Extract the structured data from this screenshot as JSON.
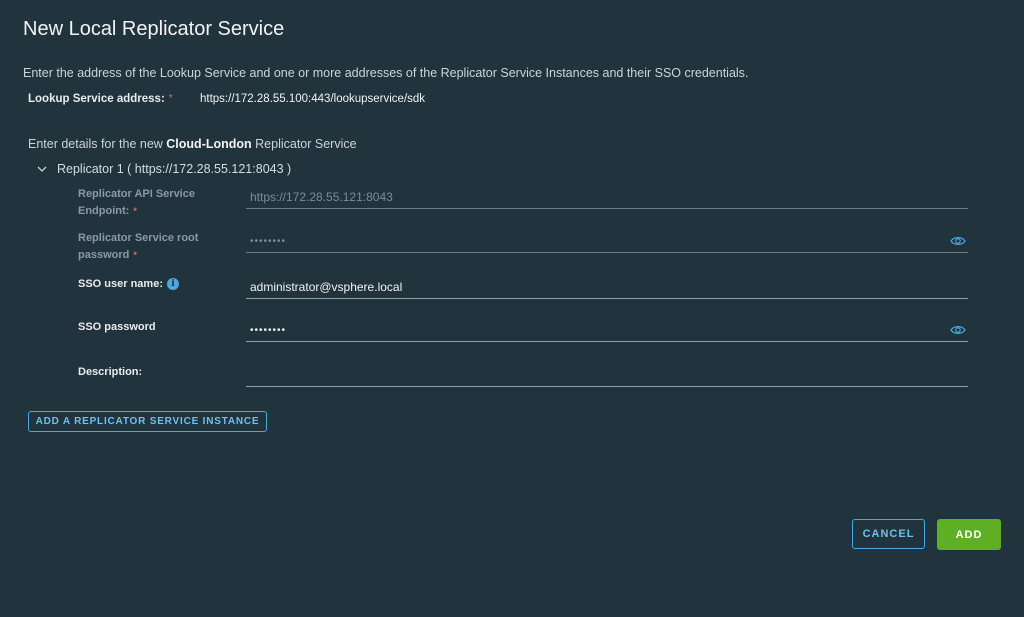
{
  "dialog": {
    "title": "New Local Replicator Service",
    "intro": "Enter the address of the Lookup Service and one or more addresses of the Replicator Service Instances and their SSO credentials."
  },
  "lookup": {
    "label": "Lookup Service address:",
    "required_mark": "*",
    "value": "https://172.28.55.100:443/lookupservice/sdk"
  },
  "details": {
    "prefix": "Enter details for the new ",
    "site_name": "Cloud-London",
    "suffix": " Replicator Service"
  },
  "replicator": {
    "header": "Replicator 1 ( https://172.28.55.121:8043 )",
    "expanded": true,
    "fields": {
      "endpoint": {
        "label_line1": "Replicator API Service",
        "label_line2": "Endpoint:",
        "required_mark": "*",
        "value": "https://172.28.55.121:8043",
        "disabled": true
      },
      "root_password": {
        "label_line1": "Replicator Service root",
        "label_line2": "password",
        "required_mark": "*",
        "value": "••••••••",
        "disabled": true,
        "icon": "eye-icon"
      },
      "sso_user": {
        "label": "SSO user name:",
        "value": "administrator@vsphere.local",
        "icon": "info-icon"
      },
      "sso_password": {
        "label": "SSO password",
        "value": "••••••••",
        "icon": "eye-icon"
      },
      "description": {
        "label": "Description:",
        "value": ""
      }
    }
  },
  "buttons": {
    "add_instance": "ADD A REPLICATOR SERVICE INSTANCE",
    "cancel": "CANCEL",
    "add": "ADD"
  },
  "colors": {
    "background": "#21333d",
    "accent": "#49a8e0",
    "primary_button": "#5eaf23",
    "required": "#f0645c"
  }
}
